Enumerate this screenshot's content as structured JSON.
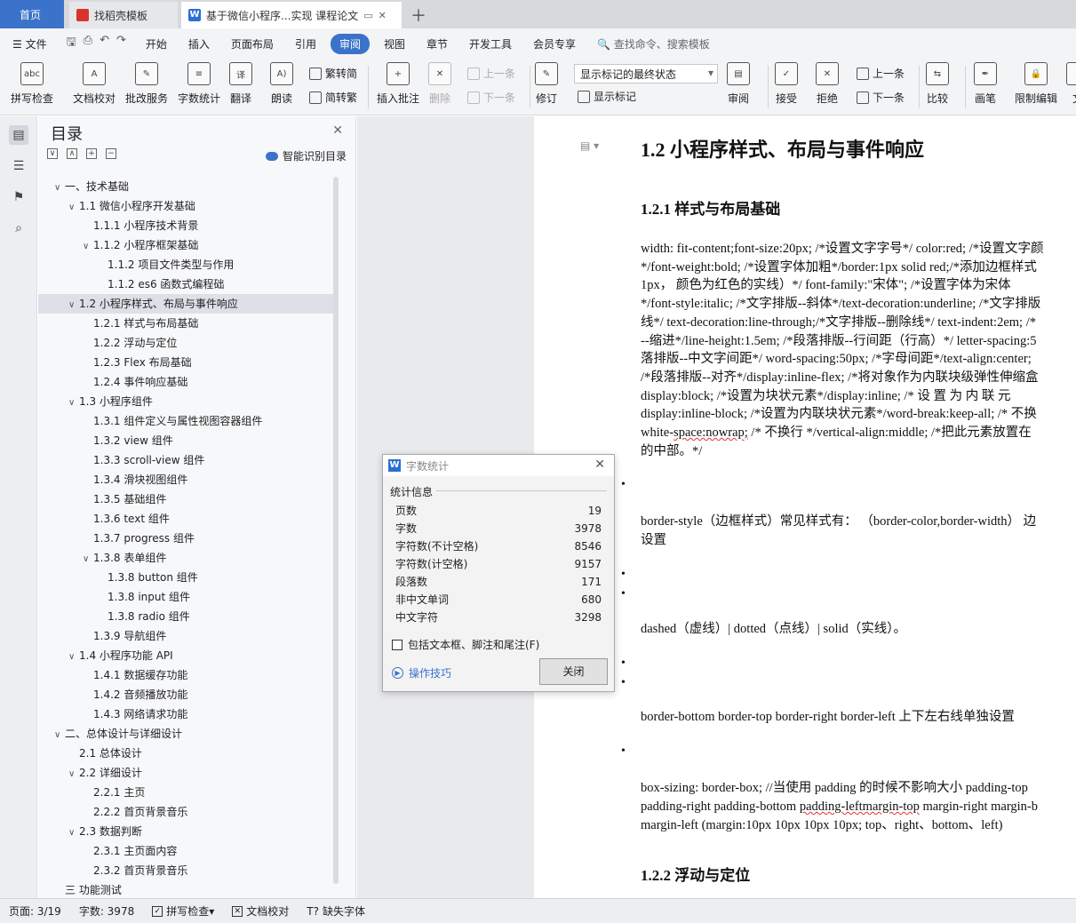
{
  "tabs": [
    {
      "label": "首页"
    },
    {
      "label": "找稻壳模板"
    },
    {
      "label": "基于微信小程序...实现 课程论文"
    }
  ],
  "menu": {
    "file": "文件",
    "items": [
      "开始",
      "插入",
      "页面布局",
      "引用",
      "审阅",
      "视图",
      "章节",
      "开发工具",
      "会员专享"
    ],
    "active": "审阅",
    "search": "查找命令、搜索模板"
  },
  "ribbon": {
    "spell": "拼写检查",
    "proofread": "文档校对",
    "batch": "批改服务",
    "wordcount": "字数统计",
    "translate": "翻译",
    "read": "朗读",
    "to_trad": "繁转简",
    "to_simp": "简转繁",
    "insert_comment": "插入批注",
    "delete": "删除",
    "prev_comment": "上一条",
    "next_comment": "下一条",
    "track": "修订",
    "markup_select": "显示标记的最终状态",
    "show_markup": "显示标记",
    "review": "审阅",
    "accept": "接受",
    "reject": "拒绝",
    "prev": "上一条",
    "next": "下一条",
    "compare": "比较",
    "pen": "画笔",
    "restrict": "限制编辑",
    "doc_extra": "文"
  },
  "toc": {
    "title": "目录",
    "smart": "智能识别目录",
    "items": [
      {
        "label": "一、技术基础",
        "level": 0,
        "caret": "∨"
      },
      {
        "label": "1.1  微信小程序开发基础",
        "level": 1,
        "caret": "∨"
      },
      {
        "label": "1.1.1  小程序技术背景",
        "level": 2,
        "caret": ""
      },
      {
        "label": "1.1.2  小程序框架基础",
        "level": 2,
        "caret": "∨"
      },
      {
        "label": "1.1.2  项目文件类型与作用",
        "level": 3,
        "caret": ""
      },
      {
        "label": "1.1.2 es6  函数式编程础",
        "level": 3,
        "caret": ""
      },
      {
        "label": "1.2  小程序样式、布局与事件响应",
        "level": 1,
        "caret": "∨",
        "selected": true
      },
      {
        "label": "1.2.1  样式与布局基础",
        "level": 2,
        "caret": ""
      },
      {
        "label": "1.2.2  浮动与定位",
        "level": 2,
        "caret": ""
      },
      {
        "label": "1.2.3 Flex  布局基础",
        "level": 2,
        "caret": ""
      },
      {
        "label": "1.2.4  事件响应基础",
        "level": 2,
        "caret": ""
      },
      {
        "label": "1.3  小程序组件",
        "level": 1,
        "caret": "∨"
      },
      {
        "label": "1.3.1  组件定义与属性视图容器组件",
        "level": 2,
        "caret": ""
      },
      {
        "label": "1.3.2 view  组件",
        "level": 2,
        "caret": ""
      },
      {
        "label": "1.3.3 scroll-view  组件",
        "level": 2,
        "caret": ""
      },
      {
        "label": "1.3.4  滑块视图组件",
        "level": 2,
        "caret": ""
      },
      {
        "label": "1.3.5  基础组件",
        "level": 2,
        "caret": ""
      },
      {
        "label": "1.3.6 text  组件",
        "level": 2,
        "caret": ""
      },
      {
        "label": "1.3.7 progress  组件",
        "level": 2,
        "caret": ""
      },
      {
        "label": "1.3.8  表单组件",
        "level": 2,
        "caret": "∨"
      },
      {
        "label": "1.3.8 button  组件",
        "level": 3,
        "caret": ""
      },
      {
        "label": "1.3.8 input  组件",
        "level": 3,
        "caret": ""
      },
      {
        "label": "1.3.8 radio  组件",
        "level": 3,
        "caret": ""
      },
      {
        "label": "1.3.9  导航组件",
        "level": 2,
        "caret": ""
      },
      {
        "label": "1.4  小程序功能  API",
        "level": 1,
        "caret": "∨"
      },
      {
        "label": "1.4.1  数据缓存功能",
        "level": 2,
        "caret": ""
      },
      {
        "label": "1.4.2  音频播放功能",
        "level": 2,
        "caret": ""
      },
      {
        "label": "1.4.3  网络请求功能",
        "level": 2,
        "caret": ""
      },
      {
        "label": "二、总体设计与详细设计",
        "level": 0,
        "caret": "∨"
      },
      {
        "label": "2.1  总体设计",
        "level": 1,
        "caret": ""
      },
      {
        "label": "2.2  详细设计",
        "level": 1,
        "caret": "∨"
      },
      {
        "label": "2.2.1  主页",
        "level": 2,
        "caret": ""
      },
      {
        "label": "2.2.2  首页背景音乐",
        "level": 2,
        "caret": ""
      },
      {
        "label": "2.3  数据判断",
        "level": 1,
        "caret": "∨"
      },
      {
        "label": "2.3.1  主页面内容",
        "level": 2,
        "caret": ""
      },
      {
        "label": "2.3.2  首页背景音乐",
        "level": 2,
        "caret": ""
      },
      {
        "label": "三   功能测试",
        "level": 0,
        "caret": ""
      }
    ]
  },
  "doc": {
    "h2": "1.2  小程序样式、布局与事件响应",
    "h3_1": "1.2.1  样式与布局基础",
    "para1": [
      "width: fit-content;font-size:20px; /*设置文字字号*/ color:red; /*设置文字颜",
      "*/font-weight:bold; /*设置字体加粗*/border:1px solid red;/*添加边框样式",
      "1px，  颜色为红色的实线）*/ font-family:\"宋体\"; /*设置字体为宋体",
      "*/font-style:italic; /*文字排版--斜体*/text-decoration:underline; /*文字排版",
      "线*/ text-decoration:line-through;/*文字排版--删除线*/ text-indent:2em; /*",
      "--缩进*/line-height:1.5em; /*段落排版--行间距（行高）*/ letter-spacing:5",
      "落排版--中文字间距*/ word-spacing:50px; /*字母间距*/text-align:center; ",
      "/*段落排版--对齐*/display:inline-flex; /*将对象作为内联块级弹性伸缩盒",
      "display:block; /*设置为块状元素*/display:inline; /*  设  置  为  内  联  元",
      "display:inline-block; /*设置为内联块状元素*/word-break:keep-all; /*  不换",
      "white-space:nowrap; /*  不换行  */vertical-align:middle; /*把此元素放置在",
      "的中部。*/"
    ],
    "para2": [
      "border-style（边框样式）常见样式有：  （border-color,border-width）  边",
      "设置"
    ],
    "para3": "dashed（虚线）| dotted（点线）| solid（实线）。",
    "para4": "border-bottom border-top border-right border-left  上下左右线单独设置",
    "para5": [
      "box-sizing: border-box; //当使用 padding 的时候不影响大小 padding-top",
      "padding-right padding-bottom padding-leftmargin-top margin-right margin-b",
      "margin-left (margin:10px 10px 10px 10px; top、right、bottom、left)"
    ],
    "h3_2": "1.2.2  浮动与定位"
  },
  "dialog": {
    "title": "字数统计",
    "group": "统计信息",
    "rows": [
      {
        "label": "页数",
        "value": "19"
      },
      {
        "label": "字数",
        "value": "3978"
      },
      {
        "label": "字符数(不计空格)",
        "value": "8546"
      },
      {
        "label": "字符数(计空格)",
        "value": "9157"
      },
      {
        "label": "段落数",
        "value": "171"
      },
      {
        "label": "非中文单词",
        "value": "680"
      },
      {
        "label": "中文字符",
        "value": "3298"
      }
    ],
    "checkbox": "包括文本框、脚注和尾注(F)",
    "tips": "操作技巧",
    "close": "关闭"
  },
  "status": {
    "page": "页面: 3/19",
    "words": "字数: 3978",
    "spell": "拼写检查",
    "proof": "文档校对",
    "font": "缺失字体"
  }
}
